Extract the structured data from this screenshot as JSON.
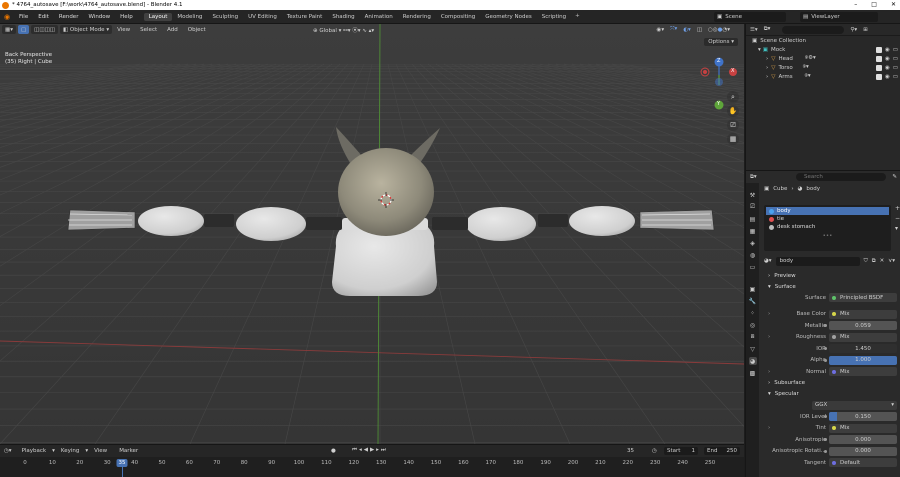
{
  "window": {
    "title": "* 4764_autosave [F:\\work\\4764_autosave.blend] - Blender 4.1",
    "controls": [
      "–",
      "□",
      "✕"
    ]
  },
  "topbar": {
    "menus": [
      "File",
      "Edit",
      "Render",
      "Window",
      "Help"
    ],
    "workspaces": [
      "Layout",
      "Modeling",
      "Sculpting",
      "UV Editing",
      "Texture Paint",
      "Shading",
      "Animation",
      "Rendering",
      "Compositing",
      "Geometry Nodes",
      "Scripting"
    ],
    "active_workspace": "Layout",
    "add_tab": "+",
    "scene": "Scene",
    "view_layer": "ViewLayer"
  },
  "viewport": {
    "mode": "Object Mode",
    "menus": [
      "View",
      "Select",
      "Add",
      "Object"
    ],
    "transform_orientation": "Global",
    "options_label": "Options",
    "overlay_line1": "Back Perspective",
    "overlay_line2": "(35) Right | Cube",
    "gizmo_axes": {
      "x": "X",
      "y": "Y",
      "z": "Z"
    }
  },
  "outliner": {
    "root": "Scene Collection",
    "collection": "Mock",
    "items": [
      "Head",
      "Torso",
      "Arms"
    ]
  },
  "properties": {
    "search_placeholder": "Search",
    "breadcrumb": {
      "object": "Cube",
      "material": "body"
    },
    "material_slots": [
      {
        "name": "body",
        "color": "#4aa3f0",
        "active": true
      },
      {
        "name": "tie",
        "color": "#e05050",
        "active": false
      },
      {
        "name": "desk stomach",
        "color": "#bbbbbb",
        "active": false
      }
    ],
    "slot_dots": "•••",
    "material_name": "body",
    "panels": {
      "preview": "Preview",
      "surface": "Surface",
      "subsurface": "Subsurface",
      "specular": "Specular"
    },
    "rows": {
      "surface": {
        "label": "Surface",
        "value": "Principled BSDF"
      },
      "base_color": {
        "label": "Base Color",
        "value": "Mix"
      },
      "metallic": {
        "label": "Metallic",
        "value": "0.059"
      },
      "roughness": {
        "label": "Roughness",
        "value": "Mix"
      },
      "ior": {
        "label": "IOR",
        "value": "1.450"
      },
      "alpha": {
        "label": "Alpha",
        "value": "1.000"
      },
      "normal": {
        "label": "Normal",
        "value": "Mix"
      },
      "distribution": {
        "label": "",
        "value": "GGX"
      },
      "ior_level": {
        "label": "IOR Level",
        "value": "0.150"
      },
      "tint": {
        "label": "Tint",
        "value": "Mix"
      },
      "anisotropic": {
        "label": "Anisotropic",
        "value": "0.000"
      },
      "aniso_rotation": {
        "label": "Anisotropic Rotati...",
        "value": "0.000"
      },
      "tangent": {
        "label": "Tangent",
        "value": "Default"
      }
    }
  },
  "timeline": {
    "menus": [
      "Playback",
      "Keying",
      "View",
      "Marker"
    ],
    "current_frame": "35",
    "start_label": "Start",
    "start": "1",
    "end_label": "End",
    "end": "250",
    "ticks": [
      "0",
      "10",
      "20",
      "30",
      "40",
      "50",
      "60",
      "70",
      "80",
      "90",
      "100",
      "110",
      "120",
      "130",
      "140",
      "150",
      "160",
      "170",
      "180",
      "190",
      "200",
      "210",
      "220",
      "230",
      "240",
      "250"
    ]
  },
  "colors": {
    "accent": "#4772b3",
    "brand": "#ea7600",
    "axis_x": "#c84141",
    "axis_y": "#5ea53a",
    "axis_z": "#3f73c9"
  }
}
